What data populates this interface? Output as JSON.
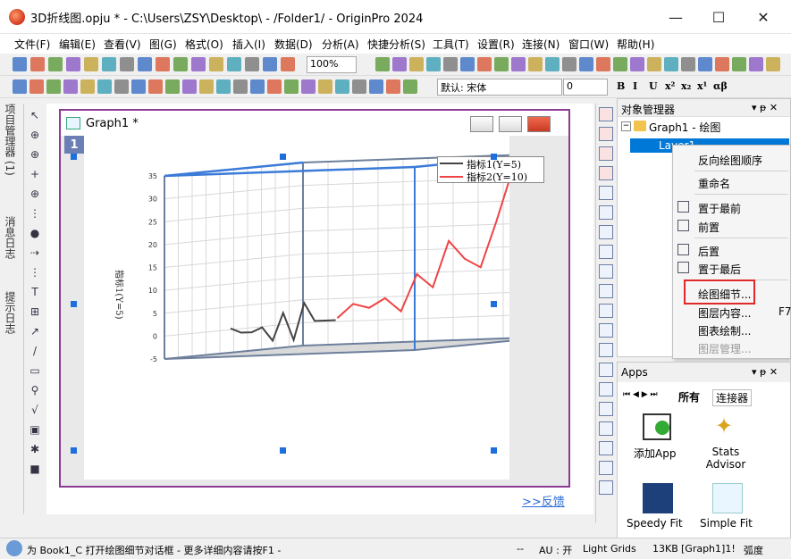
{
  "window": {
    "title": "3D折线图.opju * - C:\\Users\\ZSY\\Desktop\\ - /Folder1/ - OriginPro 2024",
    "min": "—",
    "max": "☐",
    "close": "✕"
  },
  "menus": [
    "文件(F)",
    "编辑(E)",
    "查看(V)",
    "图(G)",
    "格式(O)",
    "插入(I)",
    "数据(D)",
    "分析(A)",
    "快捷分析(S)",
    "工具(T)",
    "设置(R)",
    "连接(N)",
    "窗口(W)",
    "帮助(H)"
  ],
  "toolbar": {
    "zoom": "100%",
    "font": "默认: 宋体",
    "fontsize": "0",
    "format_buttons": [
      "B",
      "I",
      "U",
      "x²",
      "x₂",
      "x¹",
      "αβ"
    ]
  },
  "sidetabs": [
    "项目管理器 (1)",
    "消息日志",
    "提示日志"
  ],
  "graph": {
    "window_title": "Graph1 *",
    "layer_number": "1",
    "legend": [
      "指标1(Y=5)",
      "指标2(Y=10)"
    ],
    "ylabel": "指标1(Y=5)",
    "z_ticks": [
      "35",
      "30",
      "25",
      "20",
      "15",
      "10",
      "5",
      "0",
      "-5"
    ],
    "feedback": ">>反馈"
  },
  "chart_data": {
    "type": "line",
    "zlim": [
      -5,
      35
    ],
    "series": [
      {
        "name": "指标1(Y=5)",
        "color": "#444444",
        "values": [
          1,
          0,
          0,
          1,
          -2,
          4,
          -2,
          6,
          2,
          2,
          2
        ]
      },
      {
        "name": "指标2(Y=10)",
        "color": "#ee4444",
        "values": [
          1,
          4,
          3,
          5,
          2,
          10,
          7,
          17,
          13,
          11,
          21,
          32
        ]
      }
    ]
  },
  "objmgr": {
    "title": "对象管理器",
    "pin": "▾ ᵽ ✕",
    "tree": [
      "Graph1 - 绘图",
      "Layer1"
    ]
  },
  "context_menu": {
    "items": [
      "反向绘图顺序",
      "重命名",
      "置于最前",
      "前置",
      "后置",
      "置于最后",
      "绘图细节...",
      "图层内容...",
      "图表绘制...",
      "图层管理..."
    ],
    "shortcut": "F7"
  },
  "apps": {
    "title": "Apps",
    "tabs": [
      "所有",
      "连接器"
    ],
    "items": [
      "添加App",
      "Stats Advisor",
      "Speedy Fit",
      "Simple Fit"
    ]
  },
  "status": {
    "hint": "为 Book1_C 打开绘图细节对话框 - 更多详细内容请按F1 -",
    "fields": [
      "--",
      "AU : 开",
      "Light Grids",
      "13KB",
      "[Graph1]1!",
      "弧度"
    ]
  },
  "colors": {
    "accent": "#1e6fdc",
    "frame": "#8d3b94",
    "highlight": "#e0282a"
  }
}
